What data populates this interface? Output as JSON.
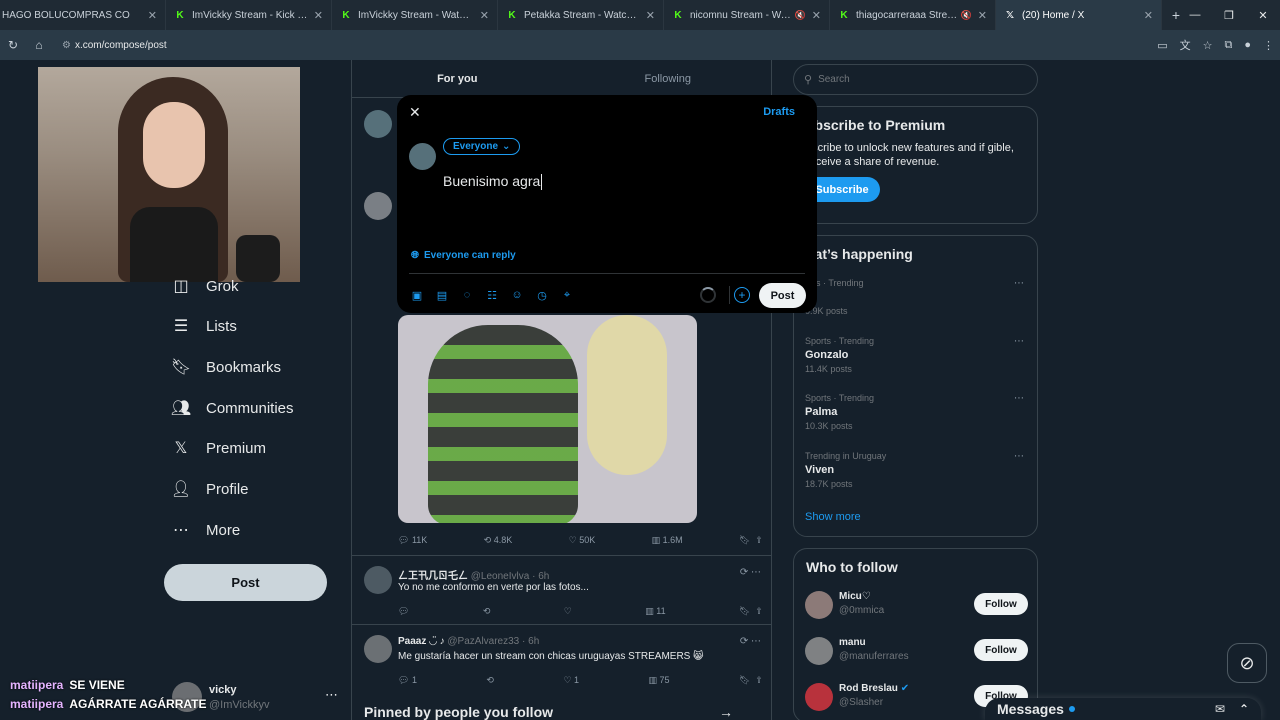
{
  "browser": {
    "tabs": [
      {
        "favicon": "tab-favicon",
        "title": "HAGO BOLUCOMPRAS CO",
        "muted": false
      },
      {
        "favicon": "kick-icon",
        "title": "ImVickky Stream - Kick Dashbo",
        "muted": false
      },
      {
        "favicon": "kick-icon",
        "title": "ImVickky Stream - Watch Live o",
        "muted": false
      },
      {
        "favicon": "kick-icon",
        "title": "Petakka Stream - Watch Live on",
        "muted": false
      },
      {
        "favicon": "kick-icon",
        "title": "nicomnu Stream - Watch Li",
        "muted": true
      },
      {
        "favicon": "kick-icon",
        "title": "thiagocarreraaa Stream - W",
        "muted": true
      },
      {
        "favicon": "x-icon",
        "title": "(20) Home / X",
        "muted": false
      }
    ],
    "url": "x.com/compose/post"
  },
  "sidebar": {
    "items": [
      {
        "icon": "grok-icon",
        "label": "Grok"
      },
      {
        "icon": "list-icon",
        "label": "Lists"
      },
      {
        "icon": "bookmark-icon",
        "label": "Bookmarks"
      },
      {
        "icon": "communities-icon",
        "label": "Communities"
      },
      {
        "icon": "x-logo-icon",
        "label": "Premium"
      },
      {
        "icon": "profile-icon",
        "label": "Profile"
      },
      {
        "icon": "more-icon",
        "label": "More"
      }
    ],
    "post_button": "Post",
    "account": {
      "name": "vicky",
      "handle": "@ImVickkyv"
    }
  },
  "chat": [
    {
      "user": "matiipera",
      "message": "SE VIENE"
    },
    {
      "user": "matiipera",
      "message": "AGÁRRATE AGÁRRATE"
    }
  ],
  "feed": {
    "tabs": [
      "For you",
      "Following"
    ],
    "main_post_stats": {
      "replies": "11K",
      "reposts": "4.8K",
      "likes": "50K",
      "views": "1.6M"
    },
    "replies": [
      {
        "name": "ㄥ㠪卂几ㄖ乇ㄥ",
        "handle": "@LeoneIvlva",
        "time": "6h",
        "text": "Yo no me conformo en verte por las fotos...",
        "likes": "",
        "views": "11",
        "replies": ""
      },
      {
        "name": "Paaaz ◡̈ ♪",
        "handle": "@PazAlvarez33",
        "time": "6h",
        "text": "Me gustaría hacer un stream con chicas uruguayas STREAMERS 😸",
        "replies": "1",
        "likes": "1",
        "views": "75"
      }
    ],
    "pinned_label": "Pinned by people you follow"
  },
  "compose": {
    "drafts": "Drafts",
    "audience": "Everyone",
    "text": "Buenisimo agra",
    "reply_setting": "Everyone can reply",
    "post": "Post"
  },
  "right": {
    "search_placeholder": "Search",
    "premium": {
      "title": "ubscribe to Premium",
      "text": "bscribe to unlock new features and if gible, receive a share of revenue.",
      "button": "Subscribe"
    },
    "happening_title": "hat’s happening",
    "trends": [
      {
        "meta": "itics · Trending",
        "name": "ile",
        "posts": "0.9K posts"
      },
      {
        "meta": "Sports · Trending",
        "name": "Gonzalo",
        "posts": "11.4K posts"
      },
      {
        "meta": "Sports · Trending",
        "name": "Palma",
        "posts": "10.3K posts"
      },
      {
        "meta": "Trending in Uruguay",
        "name": "Viven",
        "posts": "18.7K posts"
      }
    ],
    "show_more": "Show more",
    "who_to_follow": "Who to follow",
    "suggestions": [
      {
        "name": "Micu♡",
        "handle": "@0mmica",
        "button": "Follow"
      },
      {
        "name": "manu",
        "handle": "@manuferrares",
        "button": "Follow"
      },
      {
        "name": "Rod Breslau",
        "handle": "@Slasher",
        "button": "Follow"
      }
    ],
    "messages": "Messages"
  }
}
